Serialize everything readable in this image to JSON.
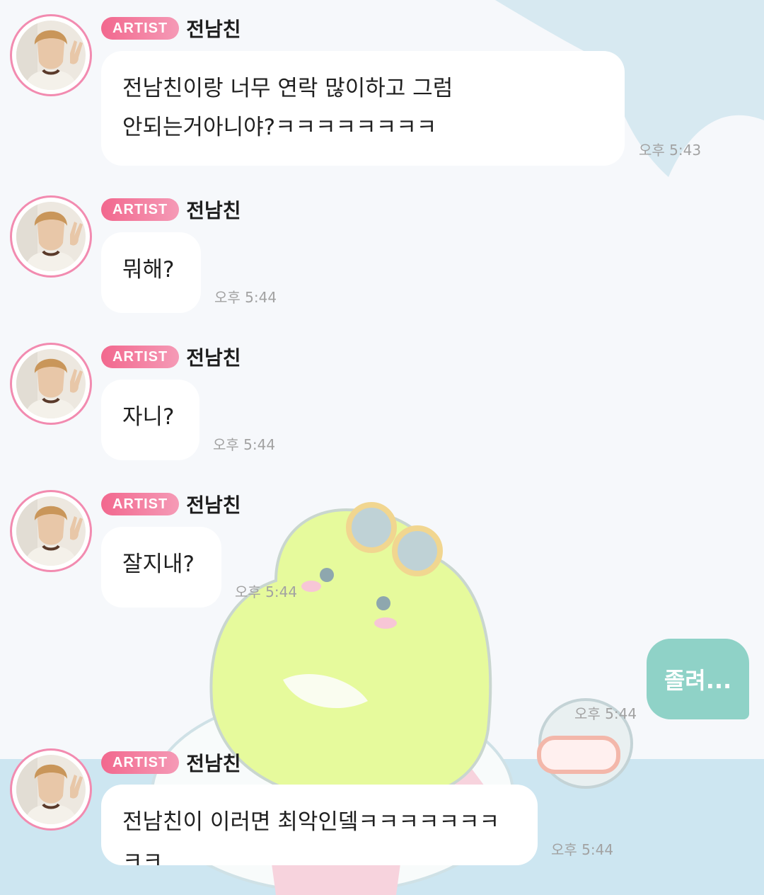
{
  "artist_badge": "ARTIST",
  "sender_name": "전남친",
  "messages": [
    {
      "text": "전남친이랑 너무 연락 많이하고 그럼\n안되는거아니야?ㅋㅋㅋㅋㅋㅋㅋㅋ",
      "time": "오후 5:43"
    },
    {
      "text": "뭐해?",
      "time": "오후 5:44"
    },
    {
      "text": "자니?",
      "time": "오후 5:44"
    },
    {
      "text": "잘지내?",
      "time": "오후 5:44"
    },
    {
      "text": "전남친이 이러면 최악인뎈ㅋㅋㅋㅋㅋㅋㅋㅋㅋ",
      "time": "오후 5:44"
    }
  ],
  "my_message": {
    "text": "졸려...",
    "time": "오후 5:44"
  },
  "colors": {
    "badge": "#f2688e",
    "my_bubble": "#8fd2c7",
    "avatar_ring": "#f28bb0"
  }
}
